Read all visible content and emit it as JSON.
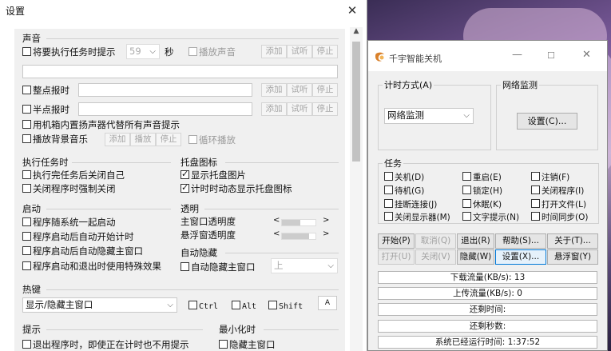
{
  "settings": {
    "title": "设置",
    "sound": {
      "label": "声音",
      "remind_label": "将要执行任务时提示",
      "seconds_value": "59",
      "seconds_unit": "秒",
      "play_sound": "播放声音",
      "btn_add": "添加",
      "btn_try": "试听",
      "btn_stop": "停止",
      "hourly": "整点报时",
      "half_hour": "半点报时",
      "pc_speaker": "用机箱内置扬声器代替所有声音提示",
      "bg_music": "播放背景音乐",
      "btn_play": "播放",
      "loop": "循环播放"
    },
    "exec": {
      "label": "执行任务时",
      "close_self": "执行完任务后关闭自己",
      "force_close": "关闭程序时强制关闭"
    },
    "tray": {
      "label": "托盘图标",
      "show_tray_img": "显示托盘图片",
      "dynamic_tray": "计时时动态显示托盘图标"
    },
    "startup": {
      "label": "启动",
      "with_system": "程序随系统一起启动",
      "auto_timer": "程序启动后自动开始计时",
      "auto_hide": "程序启动后自动隐藏主窗口",
      "special_effect": "程序启动和退出时使用特殊效果"
    },
    "opacity": {
      "label": "透明",
      "main": "主窗口透明度",
      "float": "悬浮窗透明度",
      "main_level": 0.55,
      "float_level": 0.8
    },
    "autohide": {
      "label": "自动隐藏",
      "hide_main": "自动隐藏主窗口",
      "position": "上"
    },
    "hotkey": {
      "label": "热键",
      "action": "显示/隐藏主窗口",
      "ctrl": "Ctrl",
      "alt": "Alt",
      "shift": "Shift",
      "key": "A"
    },
    "tips": {
      "label": "提示",
      "exit_no_prompt": "退出程序时，即使正在计时也不用提示"
    },
    "minimize": {
      "label": "最小化时",
      "hide_main": "隐藏主窗口"
    }
  },
  "qianyu": {
    "title": "千宇智能关机",
    "timing_mode_label": "计时方式(A)",
    "timing_mode_value": "网络监测",
    "net_monitor_label": "网络监测",
    "settings_btn": "设置(C)...",
    "tasks_label": "任务",
    "tasks": [
      [
        "关机(D)",
        "重启(E)",
        "注销(F)"
      ],
      [
        "待机(G)",
        "锁定(H)",
        "关闭程序(I)"
      ],
      [
        "挂断连接(J)",
        "休眠(K)",
        "打开文件(L)"
      ],
      [
        "关闭显示器(M)",
        "文字提示(N)",
        "时间同步(O)"
      ]
    ],
    "buttons_row1": [
      "开始(P)",
      "取消(Q)",
      "退出(R)",
      "帮助(S)...",
      "关于(T)..."
    ],
    "buttons_row2": [
      "打开(U)",
      "关闭(V)",
      "隐藏(W)",
      "设置(X)...",
      "悬浮窗(Y)"
    ],
    "info": {
      "download": "下载流量(KB/s): 13",
      "upload": "上传流量(KB/s): 0",
      "remaining_time": "还剩时间:",
      "remaining_seconds": "还剩秒数:",
      "uptime": "系统已经运行时间: 1:37:52"
    }
  }
}
